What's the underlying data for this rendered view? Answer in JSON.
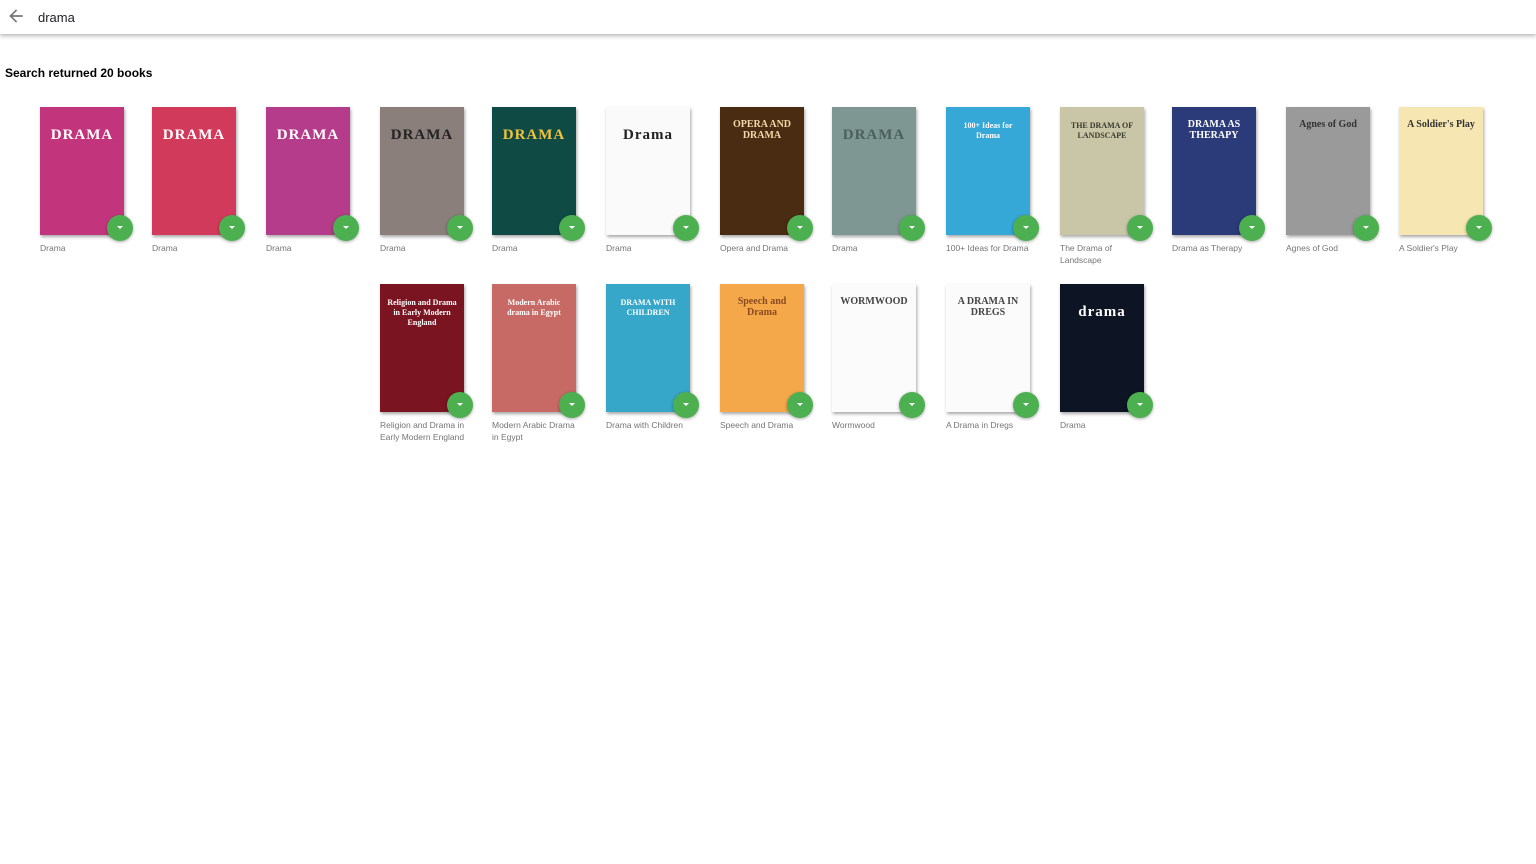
{
  "search": {
    "query": "drama"
  },
  "results": {
    "summary": "Search returned 20 books"
  },
  "books": [
    {
      "title": "Drama"
    },
    {
      "title": "Drama"
    },
    {
      "title": "Drama"
    },
    {
      "title": "Drama"
    },
    {
      "title": "Drama"
    },
    {
      "title": "Drama"
    },
    {
      "title": "Opera and Drama"
    },
    {
      "title": "Drama"
    },
    {
      "title": "100+ Ideas for Drama"
    },
    {
      "title": "The Drama of Landscape"
    },
    {
      "title": "Drama as Therapy"
    },
    {
      "title": "Agnes of God"
    },
    {
      "title": "A Soldier's Play"
    },
    {
      "title": "Religion and Drama in Early Modern England"
    },
    {
      "title": "Modern Arabic Drama in Egypt"
    },
    {
      "title": "Drama with Children"
    },
    {
      "title": "Speech and Drama"
    },
    {
      "title": "Wormwood"
    },
    {
      "title": "A Drama in Dregs"
    },
    {
      "title": "Drama"
    }
  ],
  "covers": [
    {
      "bg": "#c2357d",
      "text": "DRAMA",
      "fg": "#ffffff"
    },
    {
      "bg": "#d23a5c",
      "text": "DRAMA",
      "fg": "#ffffff"
    },
    {
      "bg": "#b43c8a",
      "text": "DRAMA",
      "fg": "#ffffff"
    },
    {
      "bg": "#8a7f7a",
      "text": "DRAMA",
      "fg": "#222222"
    },
    {
      "bg": "#0f4a44",
      "text": "DRAMA",
      "fg": "#f2c33c"
    },
    {
      "bg": "#fafafa",
      "text": "Drama",
      "fg": "#222222"
    },
    {
      "bg": "#4a2c12",
      "text": "OPERA AND DRAMA",
      "fg": "#f0d9a8"
    },
    {
      "bg": "#7f9793",
      "text": "DRAMA",
      "fg": "#49605c"
    },
    {
      "bg": "#35a8d8",
      "text": "100+ Ideas for Drama",
      "fg": "#ffffff"
    },
    {
      "bg": "#c9c6a8",
      "text": "THE DRAMA OF LANDSCAPE",
      "fg": "#3a3a2a"
    },
    {
      "bg": "#2b3a78",
      "text": "DRAMA AS THERAPY",
      "fg": "#ffffff"
    },
    {
      "bg": "#9a9a9a",
      "text": "Agnes of God",
      "fg": "#333333"
    },
    {
      "bg": "#f6e7b2",
      "text": "A Soldier's Play",
      "fg": "#333333"
    },
    {
      "bg": "#7a1420",
      "text": "Religion and Drama in Early Modern England",
      "fg": "#ffffff"
    },
    {
      "bg": "#c76a66",
      "text": "Modern Arabic drama in Egypt",
      "fg": "#ffffff"
    },
    {
      "bg": "#36a7c9",
      "text": "DRAMA WITH CHILDREN",
      "fg": "#ffffff"
    },
    {
      "bg": "#f4a84a",
      "text": "Speech and Drama",
      "fg": "#8a4a20"
    },
    {
      "bg": "#fbfbfb",
      "text": "WORMWOOD",
      "fg": "#444444"
    },
    {
      "bg": "#fbfbfb",
      "text": "A DRAMA IN DREGS",
      "fg": "#444444"
    },
    {
      "bg": "#0d1424",
      "text": "drama",
      "fg": "#ffffff"
    }
  ],
  "colors": {
    "accent": "#4caf50",
    "title_text": "#757575",
    "bar_bg": "#ffffff"
  },
  "icons": {
    "back": "arrow-back-icon",
    "download": "chevron-down-icon"
  }
}
